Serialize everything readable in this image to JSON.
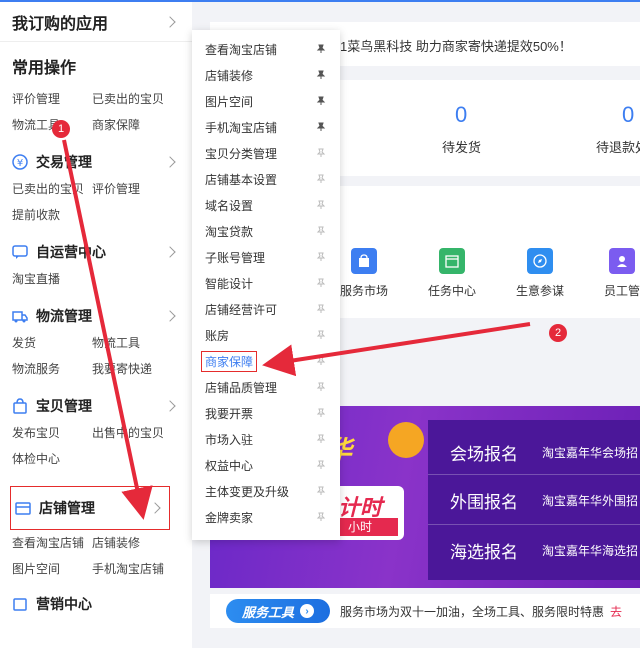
{
  "sidebar": {
    "title": "我订购的应用",
    "common": {
      "title": "常用操作",
      "links": [
        "评价管理",
        "已卖出的宝贝",
        "物流工具",
        "商家保障"
      ]
    },
    "categories": [
      {
        "label": "交易管理",
        "links": [
          "已卖出的宝贝",
          "评价管理",
          "提前收款"
        ]
      },
      {
        "label": "自运营中心",
        "links": [
          "淘宝直播"
        ]
      },
      {
        "label": "物流管理",
        "links": [
          "发货",
          "物流工具",
          "物流服务",
          "我要寄快递"
        ]
      },
      {
        "label": "宝贝管理",
        "links": [
          "发布宝贝",
          "出售中的宝贝",
          "体检中心"
        ]
      },
      {
        "label": "店铺管理",
        "links": [
          "查看淘宝店铺",
          "店铺装修",
          "图片空间",
          "手机淘宝店铺"
        ]
      },
      {
        "label": "营销中心",
        "links": []
      }
    ]
  },
  "dropdown": {
    "items": [
      "查看淘宝店铺",
      "店铺装修",
      "图片空间",
      "手机淘宝店铺",
      "宝贝分类管理",
      "店铺基本设置",
      "域名设置",
      "淘宝贷款",
      "子账号管理",
      "智能设计",
      "店铺经营许可",
      "账房",
      "商家保障",
      "店铺品质管理",
      "我要开票",
      "市场入驻",
      "权益中心",
      "主体变更及升级",
      "金牌卖家"
    ],
    "highlighted": "商家保障"
  },
  "notice": {
    "text": "1菜鸟黑科技 助力商家寄快递提效50%！"
  },
  "stats": [
    {
      "value": "0",
      "label": "待发货"
    },
    {
      "value": "0",
      "label": "待退款处"
    }
  ],
  "tools": [
    "服务市场",
    "任务中心",
    "生意参谋",
    "员工管"
  ],
  "banner": {
    "festival": "年华",
    "time_text": "计时",
    "hour": "小时",
    "rows": [
      {
        "big": "会场报名",
        "small": "淘宝嘉年华会场招"
      },
      {
        "big": "外围报名",
        "small": "淘宝嘉年华外围招"
      },
      {
        "big": "海选报名",
        "small": "淘宝嘉年华海选招"
      }
    ]
  },
  "service": {
    "badge": "服务工具",
    "text": "服务市场为双十一加油，全场工具、服务限时特惠",
    "go": "去"
  },
  "annotations": [
    "1",
    "2"
  ],
  "colors": {
    "accent": "#3d7ef1",
    "annotation": "#e5293a"
  }
}
